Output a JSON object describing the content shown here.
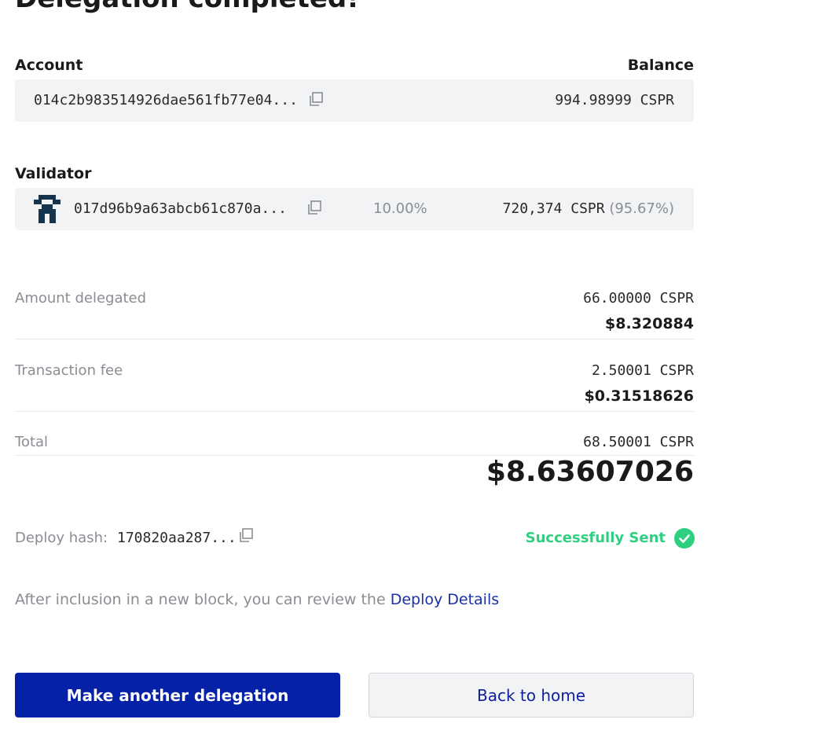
{
  "page": {
    "title": "Delegation completed!"
  },
  "account": {
    "label": "Account",
    "balance_label": "Balance",
    "address": "014c2b983514926dae561fb77e04...",
    "balance": "994.98999 CSPR"
  },
  "validator": {
    "label": "Validator",
    "address": "017d96b9a63abcb61c870a...",
    "fee": "10.00%",
    "stake": "720,374 CSPR",
    "stake_share": "(95.67%)"
  },
  "amount": {
    "label": "Amount delegated",
    "cspr": "66.00000 CSPR",
    "fiat": "$8.320884"
  },
  "fee": {
    "label": "Transaction fee",
    "cspr": "2.50001 CSPR",
    "fiat": "$0.31518626"
  },
  "total": {
    "label": "Total",
    "cspr": "68.50001 CSPR",
    "fiat": "$8.63607026"
  },
  "deploy": {
    "label": "Deploy hash:",
    "hash": "170820aa287...",
    "status": "Successfully Sent"
  },
  "info": {
    "text": "After inclusion in a new block, you can review the ",
    "link": "Deploy Details"
  },
  "buttons": {
    "primary": "Make another delegation",
    "secondary": "Back to home"
  },
  "colors": {
    "primary": "#0521a7",
    "success": "#2ecf7f",
    "link": "#1a30a8",
    "muted": "#8a8d93",
    "box_bg": "#f2f3f5"
  },
  "icons": [
    "copy-icon",
    "validator-avatar-icon",
    "check-circle-icon"
  ]
}
